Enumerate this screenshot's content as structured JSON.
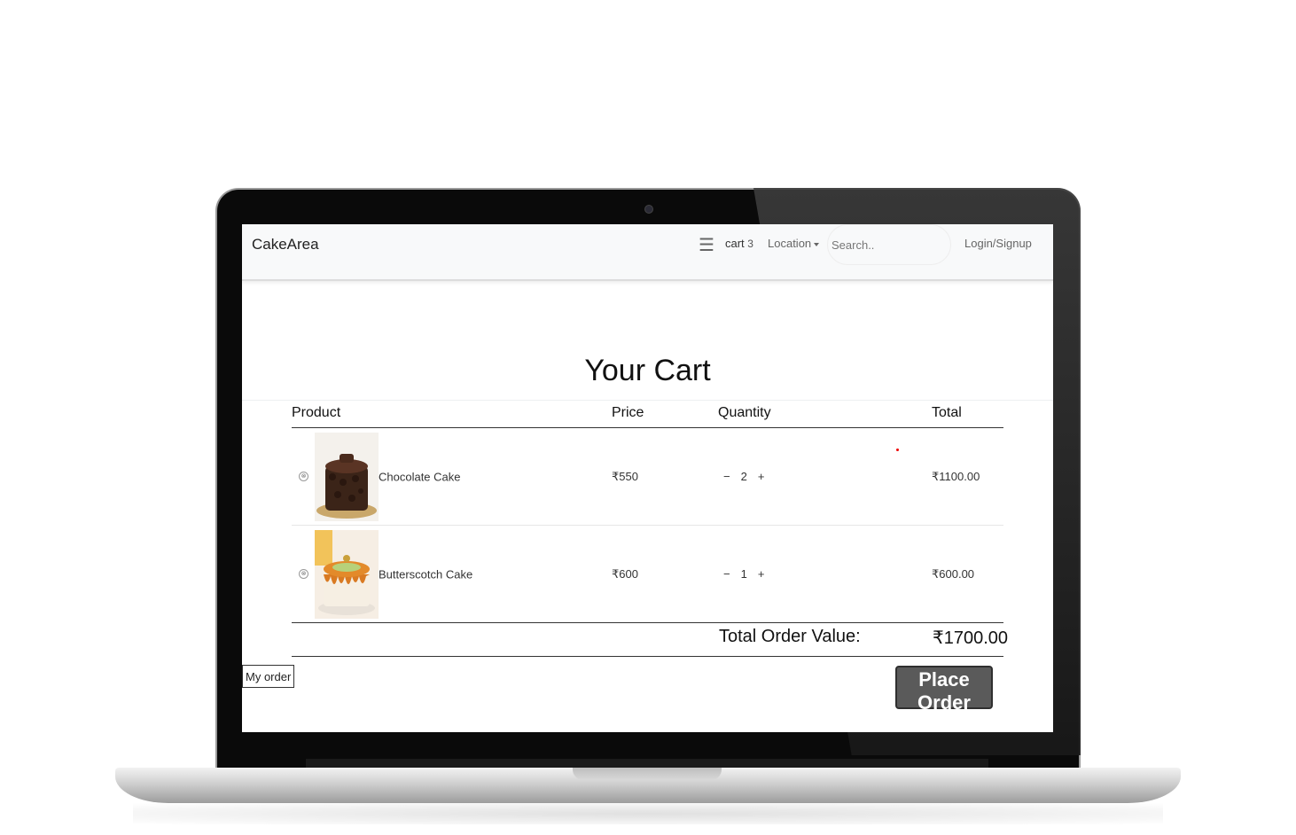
{
  "navbar": {
    "brand": "CakeArea",
    "menu_icon": "hamburger-menu-icon",
    "cart_label": "cart",
    "cart_count": "3",
    "location_label": "Location",
    "search_placeholder": "Search..",
    "login_label": "Login/Signup"
  },
  "page": {
    "title": "Your Cart"
  },
  "cart": {
    "headers": [
      "Product",
      "Price",
      "Quantity",
      "Total"
    ],
    "items": [
      {
        "name": "Chocolate Cake",
        "price": "₹550",
        "quantity": "2",
        "total": "₹1100.00",
        "image": "chocolate-cake-image"
      },
      {
        "name": "Butterscotch Cake",
        "price": "₹600",
        "quantity": "1",
        "total": "₹600.00",
        "image": "butterscotch-cake-image"
      }
    ],
    "decrement_symbol": "−",
    "increment_symbol": "+",
    "remove_symbol": "⊗"
  },
  "summary": {
    "label": "Total Order Value:",
    "value": "₹1700.00"
  },
  "actions": {
    "my_order_label": "My order",
    "place_order_label": "Place Order"
  }
}
